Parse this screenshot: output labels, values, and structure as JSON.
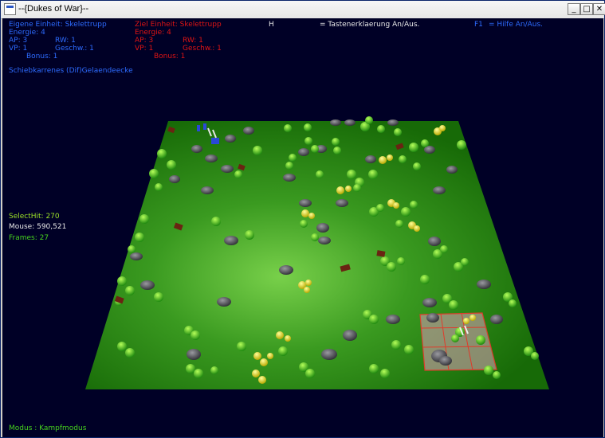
{
  "window": {
    "title": "--{Dukes of War}--",
    "minimize_icon": "minimize-icon",
    "maximize_icon": "maximize-icon",
    "close_icon": "close-icon"
  },
  "hud": {
    "own_unit": {
      "header": "Eigene Einheit: Skelettrupp",
      "energy": "Energie: 4",
      "ap": "AP: 3",
      "rw": "RW:     1",
      "vp": "VP: 1",
      "geschw": "Geschw.: 1",
      "bonus": "Bonus: 1"
    },
    "target_unit": {
      "header": "Ziel Einheit: Skelettrupp",
      "energy": "Energie: 4",
      "ap": "AP: 3",
      "rw": "RW:     1",
      "vp": "VP: 1",
      "geschw": "Geschw.: 1",
      "bonus": "Bonus: 1"
    },
    "key_h": "H",
    "key_h_desc": "= Tastenerklaerung An/Aus.",
    "key_f1": "F1",
    "key_f1_desc": "= Hilfe An/Aus.",
    "terrain": "Schiebkarrenes (Dif)Gelaendeecke",
    "select_hit": "SelectHit: 270",
    "mouse": "Mouse: 590,521",
    "frames": "Frames: 27",
    "mode": "Modus : Kampfmodus"
  },
  "colors": {
    "hud_blue": "#2d6bff",
    "hud_red": "#e01414",
    "hud_green": "#46d21e",
    "board_dark": "#1d6d0c",
    "board_light": "#6ccf3e",
    "highlight": "#ff3030",
    "background": "#000026"
  }
}
